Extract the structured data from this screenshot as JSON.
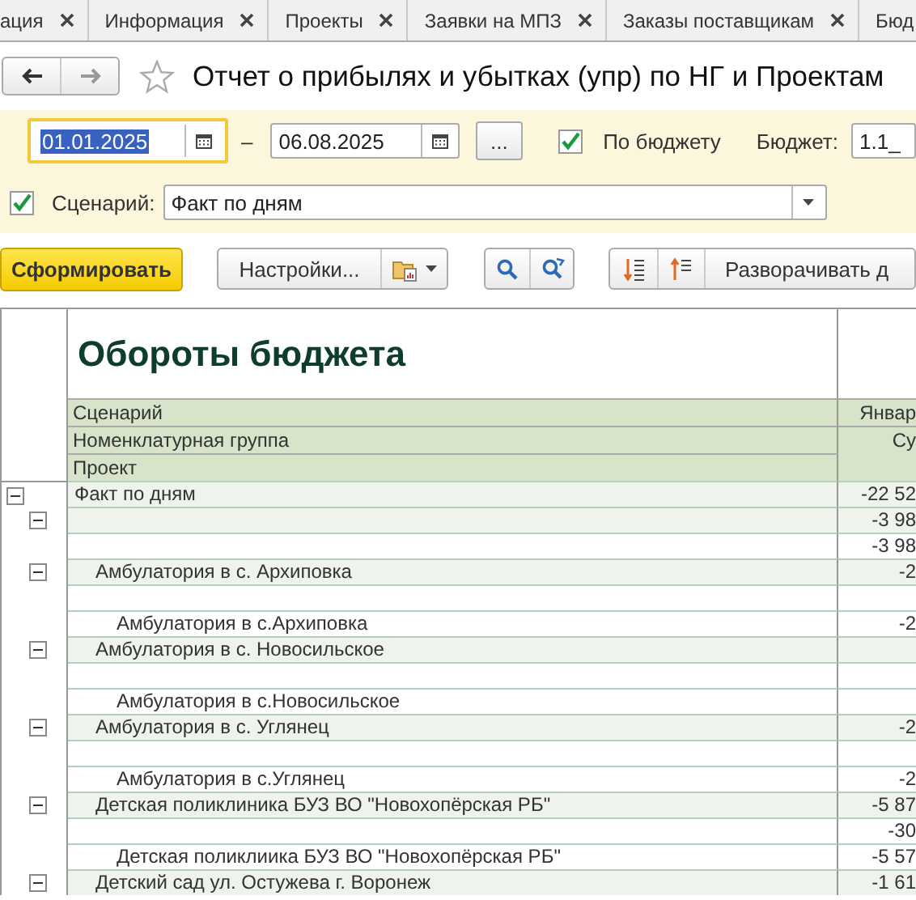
{
  "tabs": [
    {
      "label": "ация"
    },
    {
      "label": "Информация"
    },
    {
      "label": "Проекты"
    },
    {
      "label": "Заявки на МПЗ"
    },
    {
      "label": "Заказы поставщикам"
    },
    {
      "label": "Бюд"
    }
  ],
  "window": {
    "title": "Отчет о прибылях и убытках (упр) по НГ и Проектам"
  },
  "period": {
    "start": {
      "value": "01.01.2025",
      "focused": true
    },
    "dash": "–",
    "end": {
      "value": "06.08.2025",
      "focused": false
    },
    "more_button": "..."
  },
  "by_budget": {
    "label": "По бюджету",
    "checked": true
  },
  "budget": {
    "label": "Бюджет:",
    "value": "1.1_"
  },
  "scenario": {
    "label": "Сценарий:",
    "checked": true,
    "value": "Факт по дням"
  },
  "toolbar": {
    "generate": "Сформировать",
    "settings": "Настройки...",
    "expand": "Разворачивать д"
  },
  "report": {
    "title": "Обороты бюджета",
    "headers": [
      "Сценарий",
      "Номенклатурная группа",
      "Проект"
    ],
    "value_headers": [
      "Январ",
      "Су"
    ],
    "rows": [
      {
        "kind": "group",
        "name": "Факт по дням",
        "value": "-22 52",
        "expanded": true,
        "children": [
          {
            "kind": "group",
            "value": "-3 98",
            "expanded": true,
            "children": [
              {
                "kind": "project",
                "value": "-3 98"
              }
            ]
          },
          {
            "kind": "group",
            "name": "Амбулатория в с. Архиповка",
            "value": "-2",
            "expanded": true,
            "children": [
              {
                "kind": "project"
              },
              {
                "kind": "project",
                "name": "Амбулатория в с.Архиповка",
                "value": "-2"
              }
            ]
          },
          {
            "kind": "group",
            "name": "Амбулатория в с. Новосильское",
            "expanded": true,
            "children": [
              {
                "kind": "project"
              },
              {
                "kind": "project",
                "name": "Амбулатория в с.Новосильское"
              }
            ]
          },
          {
            "kind": "group",
            "name": "Амбулатория в с. Углянец",
            "value": "-2",
            "expanded": true,
            "children": [
              {
                "kind": "project"
              },
              {
                "kind": "project",
                "name": "Амбулатория в с.Углянец",
                "value": "-2"
              }
            ]
          },
          {
            "kind": "group",
            "name": "Детская поликлиника БУЗ ВО \"Новохопёрская РБ\"",
            "value": "-5 87",
            "expanded": true,
            "children": [
              {
                "kind": "project",
                "value": "-30"
              },
              {
                "kind": "project",
                "name": "Детская поликлиика БУЗ ВО \"Новохопёрская РБ\"",
                "value": "-5 57"
              }
            ]
          },
          {
            "kind": "group",
            "name": "Детский сад ул. Остужева г. Воронеж",
            "value": "-1 61",
            "expanded": true
          }
        ]
      }
    ]
  }
}
